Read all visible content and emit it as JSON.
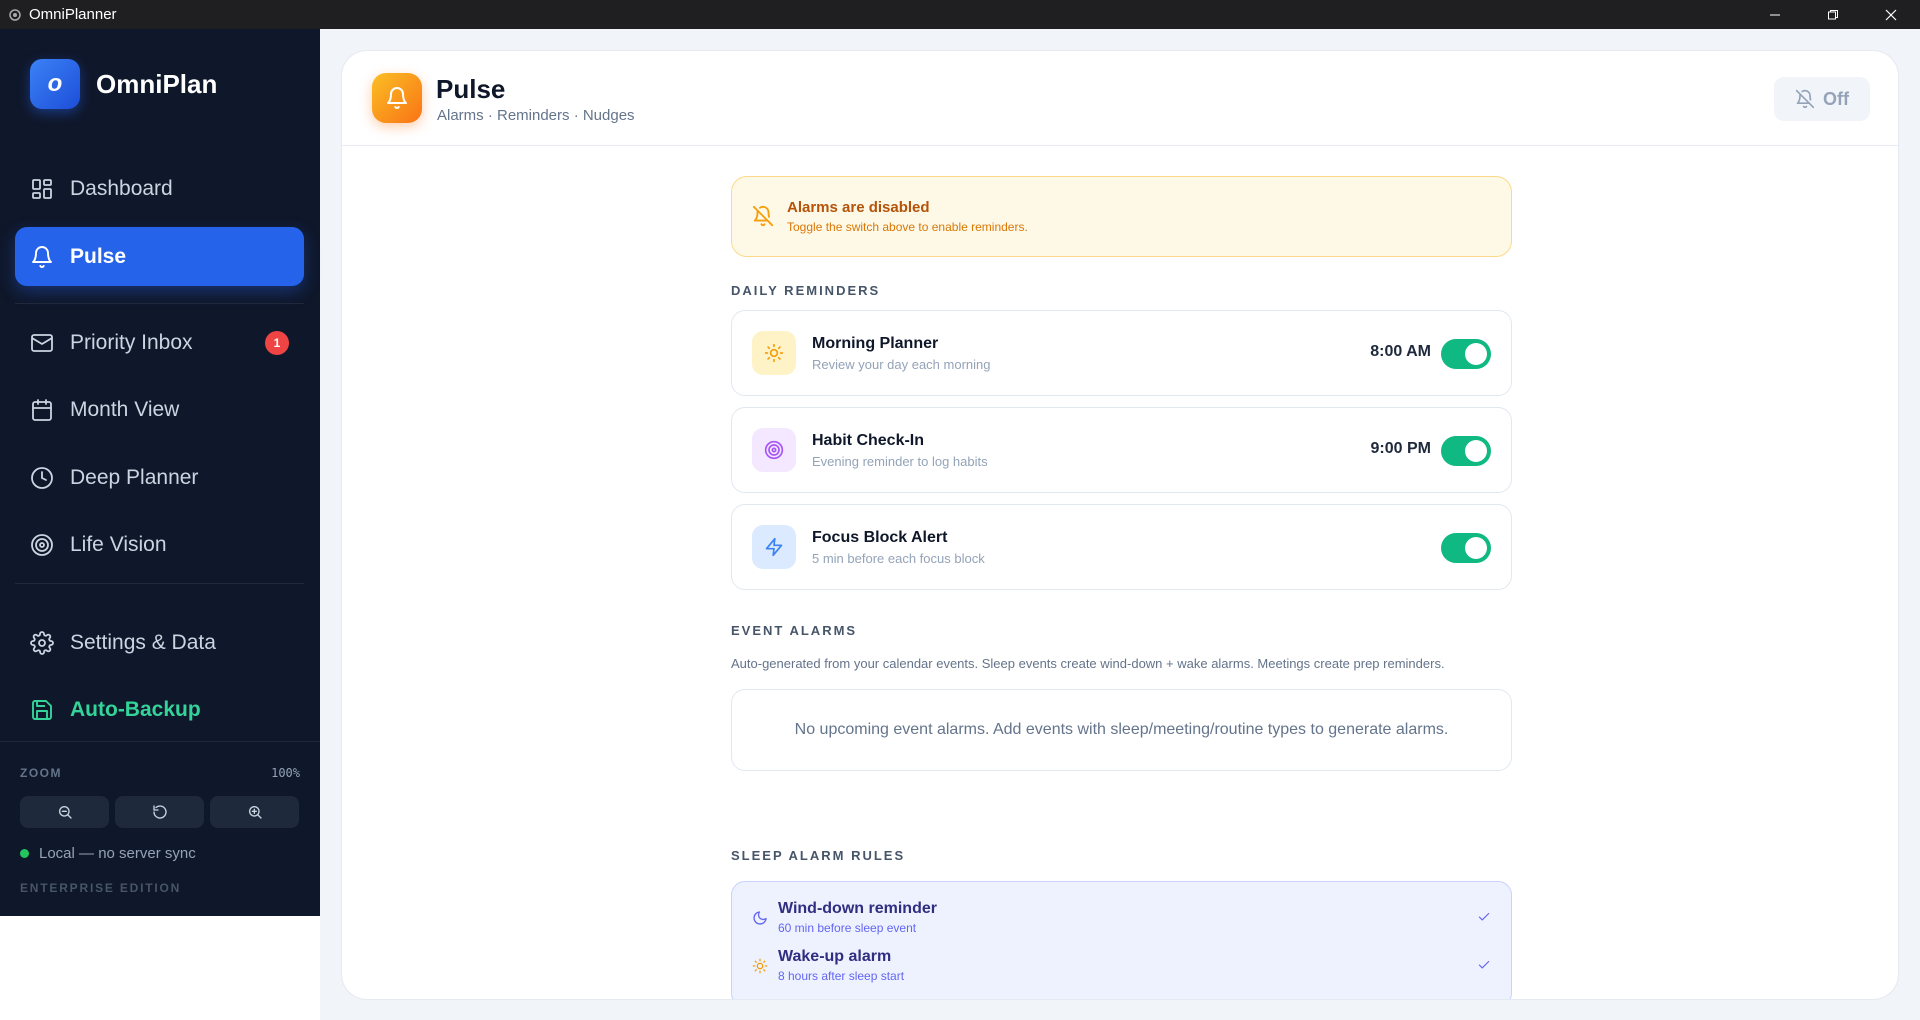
{
  "window": {
    "title": "OmniPlanner"
  },
  "sidebar": {
    "brand": "OmniPlan",
    "brand_logo_letter": "o",
    "items": [
      {
        "label": "Dashboard",
        "icon": "grid-icon"
      },
      {
        "label": "Pulse",
        "icon": "bell-icon",
        "active": true
      },
      {
        "label": "Priority Inbox",
        "icon": "mail-icon",
        "badge": "1"
      },
      {
        "label": "Month View",
        "icon": "calendar-icon"
      },
      {
        "label": "Deep Planner",
        "icon": "clock-icon"
      },
      {
        "label": "Life Vision",
        "icon": "target-icon"
      },
      {
        "label": "Settings & Data",
        "icon": "gear-icon"
      },
      {
        "label": "Auto-Backup",
        "icon": "save-icon"
      }
    ],
    "zoom": {
      "label": "ZOOM",
      "value": "100%"
    },
    "sync_status": "Local — no server sync",
    "edition": "ENTERPRISE EDITION"
  },
  "header": {
    "title": "Pulse",
    "subtitle": "Alarms · Reminders · Nudges",
    "toggle_label": "Off"
  },
  "alert": {
    "title": "Alarms are disabled",
    "text": "Toggle the switch above to enable reminders."
  },
  "daily_reminders": {
    "label": "DAILY REMINDERS",
    "items": [
      {
        "title": "Morning Planner",
        "subtitle": "Review your day each morning",
        "time": "8:00 AM",
        "enabled": true,
        "icon": "sun-icon"
      },
      {
        "title": "Habit Check-In",
        "subtitle": "Evening reminder to log habits",
        "time": "9:00 PM",
        "enabled": true,
        "icon": "target-icon"
      },
      {
        "title": "Focus Block Alert",
        "subtitle": "5 min before each focus block",
        "time": "",
        "enabled": true,
        "icon": "lightning-icon"
      }
    ]
  },
  "event_alarms": {
    "label": "EVENT ALARMS",
    "description": "Auto-generated from your calendar events. Sleep events create wind-down + wake alarms. Meetings create prep reminders.",
    "empty_text": "No upcoming event alarms. Add events with sleep/meeting/routine types to generate alarms."
  },
  "sleep_rules": {
    "label": "SLEEP ALARM RULES",
    "items": [
      {
        "title": "Wind-down reminder",
        "subtitle": "60 min before sleep event",
        "icon": "moon-icon"
      },
      {
        "title": "Wake-up alarm",
        "subtitle": "8 hours after sleep start",
        "icon": "sun-icon"
      }
    ]
  },
  "colors": {
    "sidebar_bg": "#0f172a",
    "accent": "#2563eb",
    "toggle_on": "#10b981",
    "badge": "#ef4444",
    "warning": "#b45309"
  }
}
